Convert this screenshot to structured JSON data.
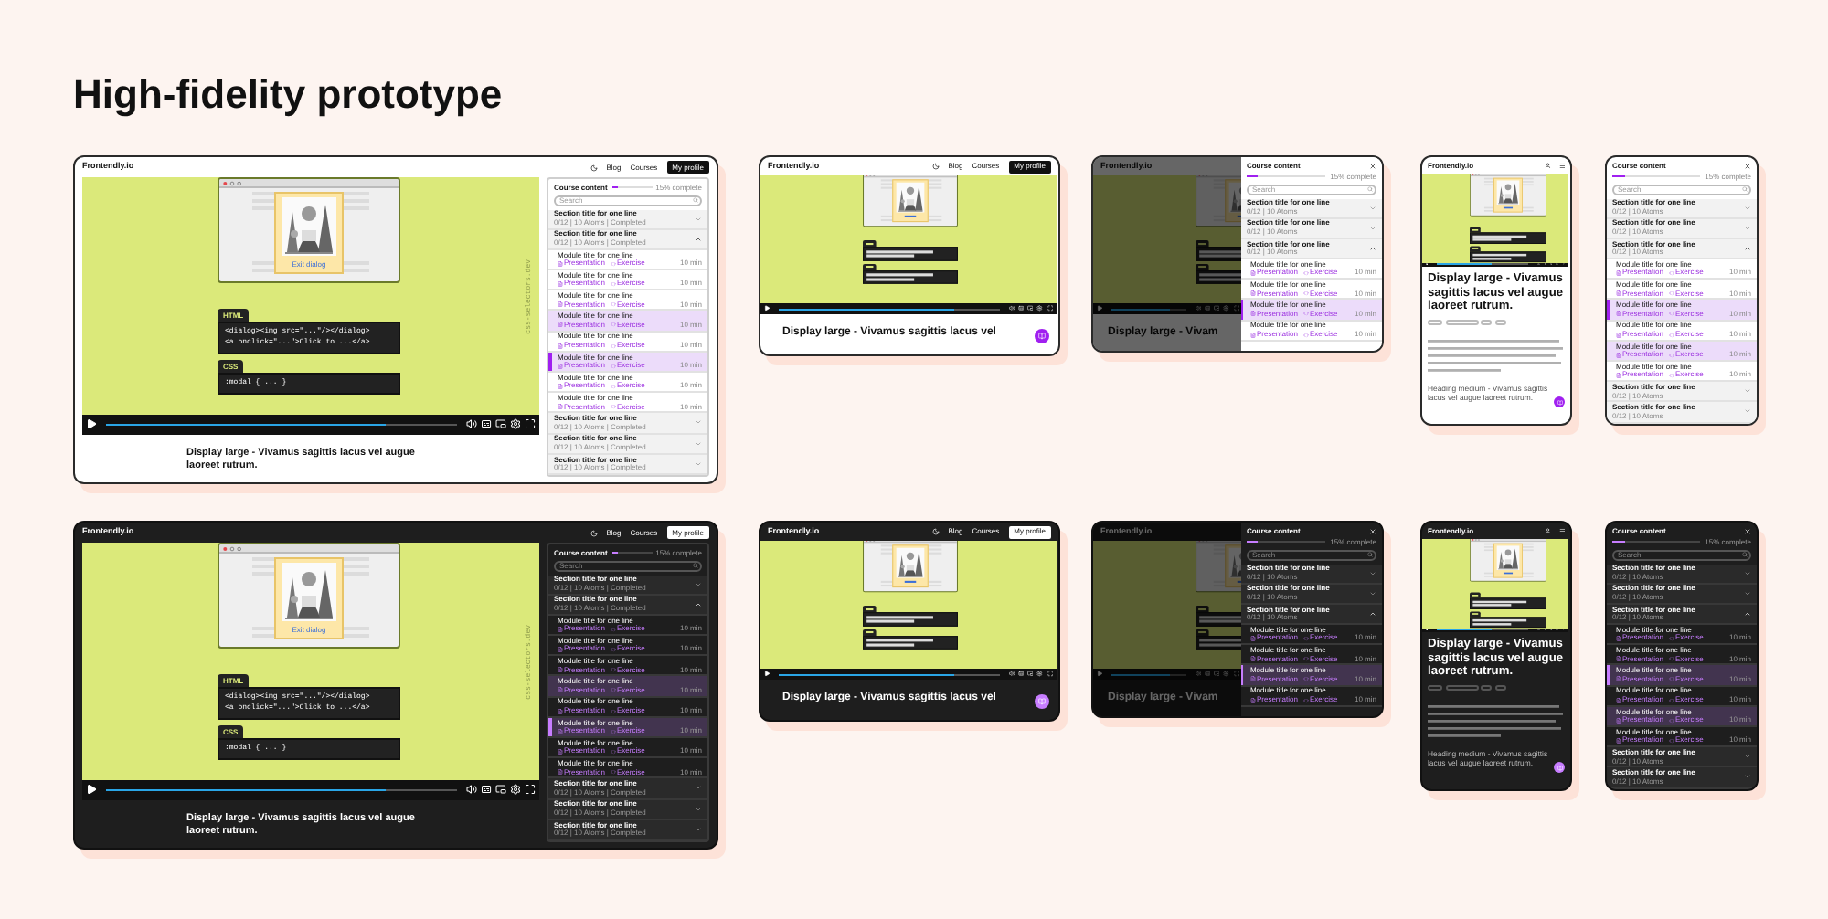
{
  "title": "High-fidelity prototype",
  "rows": [
    {
      "dark": false,
      "desktop": {
        "logo": "Frontendly.io",
        "nav": [
          "Blog",
          "Courses"
        ],
        "profile": "My profile",
        "video": {
          "exit_link": "Exit dialog",
          "side_label": "css-selectors.dev",
          "level": 0.8,
          "code": [
            {
              "label": "HTML",
              "lines": [
                "<dialog><img src=\"...\"/></dialog>",
                "<a onclick=\"...\">Click to ...</a>"
              ]
            },
            {
              "label": "CSS",
              "lines": [
                ":modal  { ... }"
              ]
            }
          ]
        },
        "heading": "Display large - Vivamus sagittis lacus vel augue laoreet rutrum.",
        "course": {
          "title": "Course content",
          "progress": {
            "level": 0.15,
            "label": "15% complete"
          },
          "search": {
            "placeholder": "Search"
          },
          "items": [
            {
              "kind": "section",
              "title": "Section title for one line",
              "meta": "0/12 | 10 Atoms | Completed",
              "expanded": false
            },
            {
              "kind": "section",
              "title": "Section title for one line",
              "meta": "0/12 | 10 Atoms | Completed",
              "expanded": true
            },
            {
              "kind": "module",
              "title": "Module title for one line",
              "links": [
                "Presentation",
                "Exercise"
              ],
              "duration": "10 min",
              "selected": false,
              "highlighted": false
            },
            {
              "kind": "module",
              "title": "Module title for one line",
              "links": [
                "Presentation",
                "Exercise"
              ],
              "duration": "10 min",
              "selected": false,
              "highlighted": false
            },
            {
              "kind": "module",
              "title": "Module title for one line",
              "links": [
                "Presentation",
                "Exercise"
              ],
              "duration": "10 min",
              "selected": false,
              "highlighted": false
            },
            {
              "kind": "module",
              "title": "Module title for one line",
              "links": [
                "Presentation",
                "Exercise"
              ],
              "duration": "10 min",
              "selected": false,
              "highlighted": true
            },
            {
              "kind": "module",
              "title": "Module title for one line",
              "links": [
                "Presentation",
                "Exercise"
              ],
              "duration": "10 min",
              "selected": false,
              "highlighted": false
            },
            {
              "kind": "module",
              "title": "Module title for one line",
              "links": [
                "Presentation",
                "Exercise"
              ],
              "duration": "10 min",
              "selected": true,
              "highlighted": true
            },
            {
              "kind": "module",
              "title": "Module title for one line",
              "links": [
                "Presentation",
                "Exercise"
              ],
              "duration": "10 min",
              "selected": false,
              "highlighted": false
            },
            {
              "kind": "module",
              "title": "Module title for one line",
              "links": [
                "Presentation",
                "Exercise"
              ],
              "duration": "10 min",
              "selected": false,
              "highlighted": false
            },
            {
              "kind": "section",
              "title": "Section title for one line",
              "meta": "0/12 | 10 Atoms | Completed",
              "expanded": false
            },
            {
              "kind": "section",
              "title": "Section title for one line",
              "meta": "0/12 | 10 Atoms | Completed",
              "expanded": false
            },
            {
              "kind": "section",
              "title": "Section title for one line",
              "meta": "0/12 | 10 Atoms | Completed",
              "expanded": false
            }
          ]
        }
      },
      "tablet": {
        "logo": "Frontendly.io",
        "nav": [
          "Blog",
          "Courses"
        ],
        "profile": "My profile",
        "video": {
          "level": 0.8
        },
        "heading": "Display large - Vivamus sagittis lacus vel"
      },
      "tablet_drawer": {
        "logo": "Frontendly.io",
        "heading": "Display large - Vivam",
        "course": {
          "title": "Course content",
          "progress": {
            "level": 0.15,
            "label": "15% complete"
          },
          "search": {
            "placeholder": "Search"
          },
          "items": [
            {
              "kind": "section",
              "title": "Section title for one line",
              "meta": "0/12 | 10 Atoms",
              "expanded": false
            },
            {
              "kind": "section",
              "title": "Section title for one line",
              "meta": "0/12 | 10 Atoms",
              "expanded": false
            },
            {
              "kind": "section",
              "title": "Section title for one line",
              "meta": "0/12 | 10 Atoms",
              "expanded": true
            },
            {
              "kind": "module",
              "title": "Module title for one line",
              "links": [
                "Presentation",
                "Exercise"
              ],
              "duration": "10 min",
              "selected": false,
              "highlighted": false
            },
            {
              "kind": "module",
              "title": "Module title for one line",
              "links": [
                "Presentation",
                "Exercise"
              ],
              "duration": "10 min",
              "selected": false,
              "highlighted": false
            },
            {
              "kind": "module",
              "title": "Module title for one line",
              "links": [
                "Presentation",
                "Exercise"
              ],
              "duration": "10 min",
              "selected": true,
              "highlighted": true
            },
            {
              "kind": "module",
              "title": "Module title for one line",
              "links": [
                "Presentation",
                "Exercise"
              ],
              "duration": "10 min",
              "selected": false,
              "highlighted": false
            }
          ]
        }
      },
      "mobile": {
        "logo": "Frontendly.io",
        "video": {
          "level": 0.6
        },
        "heading": "Display large - Vivamus sagittis lacus vel augue laoreet rutrum.",
        "subheading": "Heading medium - Vivamus sagittis lacus vel augue laoreet rutrum."
      },
      "mobile_drawer": {
        "course": {
          "title": "Course content",
          "progress": {
            "level": 0.15,
            "label": "15% complete"
          },
          "search": {
            "placeholder": "Search"
          },
          "items": [
            {
              "kind": "section",
              "title": "Section title for one line",
              "meta": "0/12 | 10 Atoms",
              "expanded": false
            },
            {
              "kind": "section",
              "title": "Section title for one line",
              "meta": "0/12 | 10 Atoms",
              "expanded": false
            },
            {
              "kind": "section",
              "title": "Section title for one line",
              "meta": "0/12 | 10 Atoms",
              "expanded": true
            },
            {
              "kind": "module",
              "title": "Module title for one line",
              "links": [
                "Presentation",
                "Exercise"
              ],
              "duration": "10 min",
              "selected": false,
              "highlighted": false
            },
            {
              "kind": "module",
              "title": "Module title for one line",
              "links": [
                "Presentation",
                "Exercise"
              ],
              "duration": "10 min",
              "selected": false,
              "highlighted": false
            },
            {
              "kind": "module",
              "title": "Module title for one line",
              "links": [
                "Presentation",
                "Exercise"
              ],
              "duration": "10 min",
              "selected": true,
              "highlighted": true
            },
            {
              "kind": "module",
              "title": "Module title for one line",
              "links": [
                "Presentation",
                "Exercise"
              ],
              "duration": "10 min",
              "selected": false,
              "highlighted": false
            },
            {
              "kind": "module",
              "title": "Module title for one line",
              "links": [
                "Presentation",
                "Exercise"
              ],
              "duration": "10 min",
              "selected": false,
              "highlighted": true
            },
            {
              "kind": "module",
              "title": "Module title for one line",
              "links": [
                "Presentation",
                "Exercise"
              ],
              "duration": "10 min",
              "selected": false,
              "highlighted": false
            },
            {
              "kind": "section",
              "title": "Section title for one line",
              "meta": "0/12 | 10 Atoms",
              "expanded": false
            },
            {
              "kind": "section",
              "title": "Section title for one line",
              "meta": "0/12 | 10 Atoms",
              "expanded": false
            }
          ]
        }
      }
    },
    {
      "dark": true,
      "desktop": {
        "logo": "Frontendly.io",
        "nav": [
          "Blog",
          "Courses"
        ],
        "profile": "My profile",
        "video": {
          "exit_link": "Exit dialog",
          "side_label": "css-selectors.dev",
          "level": 0.8,
          "code": [
            {
              "label": "HTML",
              "lines": [
                "<dialog><img src=\"...\"/></dialog>",
                "<a onclick=\"...\">Click to ...</a>"
              ]
            },
            {
              "label": "CSS",
              "lines": [
                ":modal  { ... }"
              ]
            }
          ]
        },
        "heading": "Display large - Vivamus sagittis lacus vel augue laoreet rutrum.",
        "course": {
          "title": "Course content",
          "progress": {
            "level": 0.15,
            "label": "15% complete"
          },
          "search": {
            "placeholder": "Search"
          },
          "items": [
            {
              "kind": "section",
              "title": "Section title for one line",
              "meta": "0/12 | 10 Atoms | Completed",
              "expanded": false
            },
            {
              "kind": "section",
              "title": "Section title for one line",
              "meta": "0/12 | 10 Atoms | Completed",
              "expanded": true
            },
            {
              "kind": "module",
              "title": "Module title for one line",
              "links": [
                "Presentation",
                "Exercise"
              ],
              "duration": "10 min",
              "selected": false,
              "highlighted": false
            },
            {
              "kind": "module",
              "title": "Module title for one line",
              "links": [
                "Presentation",
                "Exercise"
              ],
              "duration": "10 min",
              "selected": false,
              "highlighted": false
            },
            {
              "kind": "module",
              "title": "Module title for one line",
              "links": [
                "Presentation",
                "Exercise"
              ],
              "duration": "10 min",
              "selected": false,
              "highlighted": false
            },
            {
              "kind": "module",
              "title": "Module title for one line",
              "links": [
                "Presentation",
                "Exercise"
              ],
              "duration": "10 min",
              "selected": false,
              "highlighted": true
            },
            {
              "kind": "module",
              "title": "Module title for one line",
              "links": [
                "Presentation",
                "Exercise"
              ],
              "duration": "10 min",
              "selected": false,
              "highlighted": false
            },
            {
              "kind": "module",
              "title": "Module title for one line",
              "links": [
                "Presentation",
                "Exercise"
              ],
              "duration": "10 min",
              "selected": true,
              "highlighted": true
            },
            {
              "kind": "module",
              "title": "Module title for one line",
              "links": [
                "Presentation",
                "Exercise"
              ],
              "duration": "10 min",
              "selected": false,
              "highlighted": false
            },
            {
              "kind": "module",
              "title": "Module title for one line",
              "links": [
                "Presentation",
                "Exercise"
              ],
              "duration": "10 min",
              "selected": false,
              "highlighted": false
            },
            {
              "kind": "section",
              "title": "Section title for one line",
              "meta": "0/12 | 10 Atoms | Completed",
              "expanded": false
            },
            {
              "kind": "section",
              "title": "Section title for one line",
              "meta": "0/12 | 10 Atoms | Completed",
              "expanded": false
            },
            {
              "kind": "section",
              "title": "Section title for one line",
              "meta": "0/12 | 10 Atoms | Completed",
              "expanded": false
            }
          ]
        }
      },
      "tablet": {
        "logo": "Frontendly.io",
        "nav": [
          "Blog",
          "Courses"
        ],
        "profile": "My profile",
        "video": {
          "level": 0.8
        },
        "heading": "Display large - Vivamus sagittis lacus vel"
      },
      "tablet_drawer": {
        "logo": "Frontendly.io",
        "heading": "Display large - Vivam",
        "course": {
          "title": "Course content",
          "progress": {
            "level": 0.15,
            "label": "15% complete"
          },
          "search": {
            "placeholder": "Search"
          },
          "items": [
            {
              "kind": "section",
              "title": "Section title for one line",
              "meta": "0/12 | 10 Atoms",
              "expanded": false
            },
            {
              "kind": "section",
              "title": "Section title for one line",
              "meta": "0/12 | 10 Atoms",
              "expanded": false
            },
            {
              "kind": "section",
              "title": "Section title for one line",
              "meta": "0/12 | 10 Atoms",
              "expanded": true
            },
            {
              "kind": "module",
              "title": "Module title for one line",
              "links": [
                "Presentation",
                "Exercise"
              ],
              "duration": "10 min",
              "selected": false,
              "highlighted": false
            },
            {
              "kind": "module",
              "title": "Module title for one line",
              "links": [
                "Presentation",
                "Exercise"
              ],
              "duration": "10 min",
              "selected": false,
              "highlighted": false
            },
            {
              "kind": "module",
              "title": "Module title for one line",
              "links": [
                "Presentation",
                "Exercise"
              ],
              "duration": "10 min",
              "selected": true,
              "highlighted": true
            },
            {
              "kind": "module",
              "title": "Module title for one line",
              "links": [
                "Presentation",
                "Exercise"
              ],
              "duration": "10 min",
              "selected": false,
              "highlighted": false
            }
          ]
        }
      },
      "mobile": {
        "logo": "Frontendly.io",
        "video": {
          "level": 0.6
        },
        "heading": "Display large - Vivamus sagittis lacus vel augue laoreet rutrum.",
        "subheading": "Heading medium - Vivamus sagittis lacus vel augue laoreet rutrum."
      },
      "mobile_drawer": {
        "course": {
          "title": "Course content",
          "progress": {
            "level": 0.15,
            "label": "15% complete"
          },
          "search": {
            "placeholder": "Search"
          },
          "items": [
            {
              "kind": "section",
              "title": "Section title for one line",
              "meta": "0/12 | 10 Atoms",
              "expanded": false
            },
            {
              "kind": "section",
              "title": "Section title for one line",
              "meta": "0/12 | 10 Atoms",
              "expanded": false
            },
            {
              "kind": "section",
              "title": "Section title for one line",
              "meta": "0/12 | 10 Atoms",
              "expanded": true
            },
            {
              "kind": "module",
              "title": "Module title for one line",
              "links": [
                "Presentation",
                "Exercise"
              ],
              "duration": "10 min",
              "selected": false,
              "highlighted": false
            },
            {
              "kind": "module",
              "title": "Module title for one line",
              "links": [
                "Presentation",
                "Exercise"
              ],
              "duration": "10 min",
              "selected": false,
              "highlighted": false
            },
            {
              "kind": "module",
              "title": "Module title for one line",
              "links": [
                "Presentation",
                "Exercise"
              ],
              "duration": "10 min",
              "selected": true,
              "highlighted": true
            },
            {
              "kind": "module",
              "title": "Module title for one line",
              "links": [
                "Presentation",
                "Exercise"
              ],
              "duration": "10 min",
              "selected": false,
              "highlighted": false
            },
            {
              "kind": "module",
              "title": "Module title for one line",
              "links": [
                "Presentation",
                "Exercise"
              ],
              "duration": "10 min",
              "selected": false,
              "highlighted": true
            },
            {
              "kind": "module",
              "title": "Module title for one line",
              "links": [
                "Presentation",
                "Exercise"
              ],
              "duration": "10 min",
              "selected": false,
              "highlighted": false
            },
            {
              "kind": "section",
              "title": "Section title for one line",
              "meta": "0/12 | 10 Atoms",
              "expanded": false
            },
            {
              "kind": "section",
              "title": "Section title for one line",
              "meta": "0/12 | 10 Atoms",
              "expanded": false
            }
          ]
        }
      }
    }
  ]
}
